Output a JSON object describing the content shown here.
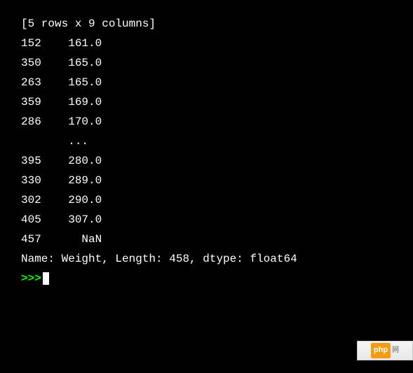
{
  "header": {
    "shape_info": "[5 rows x 9 columns]"
  },
  "rows_top": [
    {
      "index": "152",
      "value": "161.0"
    },
    {
      "index": "350",
      "value": "165.0"
    },
    {
      "index": "263",
      "value": "165.0"
    },
    {
      "index": "359",
      "value": "169.0"
    },
    {
      "index": "286",
      "value": "170.0"
    }
  ],
  "ellipsis": "       ...  ",
  "rows_bottom": [
    {
      "index": "395",
      "value": "280.0"
    },
    {
      "index": "330",
      "value": "289.0"
    },
    {
      "index": "302",
      "value": "290.0"
    },
    {
      "index": "405",
      "value": "307.0"
    },
    {
      "index": "457",
      "value": "  NaN"
    }
  ],
  "summary": "Name: Weight, Length: 458, dtype: float64",
  "prompt": ">>>",
  "watermark": {
    "logo": "php",
    "text": "网"
  }
}
